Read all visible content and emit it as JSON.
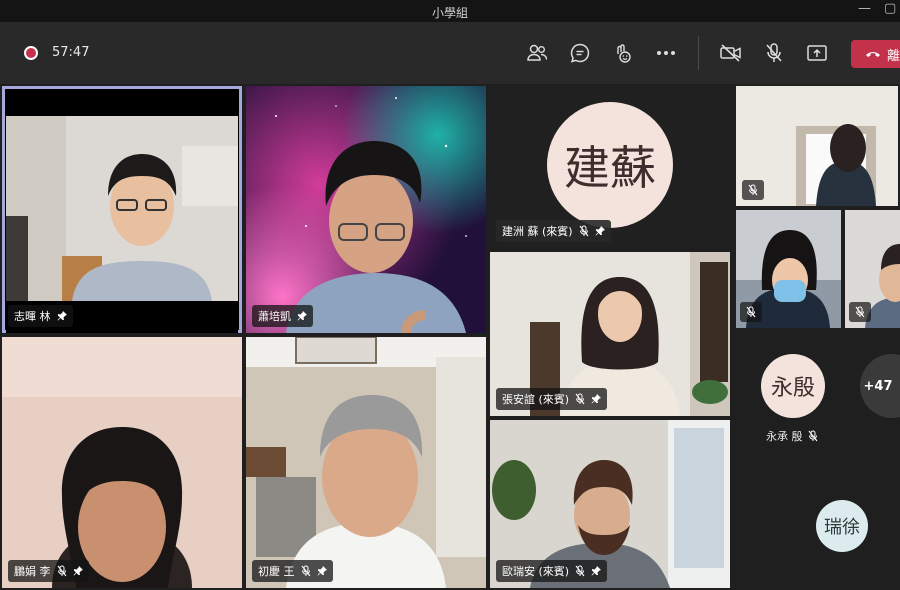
{
  "window": {
    "title": "小學組"
  },
  "toolbar": {
    "timer": "57:47",
    "leave_label": "離"
  },
  "participants": {
    "p1": {
      "name": "志暉 林"
    },
    "p2": {
      "name": "蕭培凱"
    },
    "p3": {
      "name": "建洲 蘇 (來賓)",
      "initials": "建蘇"
    },
    "p4": {
      "name": "張安誼 (來賓)"
    },
    "p5": {
      "name": "歐瑞安 (來賓)"
    },
    "p6": {
      "name": "鵬娟 李"
    },
    "p7": {
      "name": "初慶 王"
    },
    "p8": {
      "name": "永承 殷",
      "initials": "永殷"
    },
    "p9": {
      "initials": "瑞徐"
    }
  },
  "overflow": {
    "count": "+47"
  },
  "colors": {
    "pinned_outline": "#a6a7dc",
    "leave": "#c4314b",
    "avatar_bg": "#f3e3dc"
  }
}
